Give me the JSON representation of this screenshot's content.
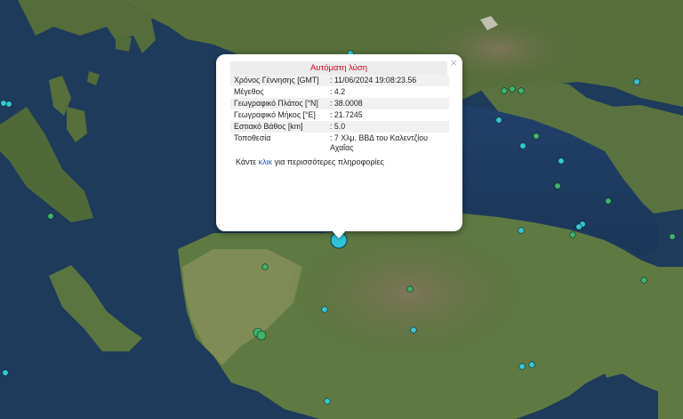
{
  "map": {
    "colors": {
      "sea": "#1d3a5a",
      "land": "#556f3d",
      "mountain": "#6b6a4d",
      "marker_small_cyan": "#35c6d6",
      "marker_small_green": "#3fb36b",
      "marker_main": "#2fc4d8"
    }
  },
  "popup": {
    "title": "Αυτόματη λύση",
    "close_glyph": "×",
    "rows": [
      {
        "label": "Χρόνος Γέννησης [GMT]",
        "value": ": 11/06/2024 19:08:23.56"
      },
      {
        "label": "Μέγεθος",
        "value": ": 4.2"
      },
      {
        "label": "Γεωγραφικό Πλάτος [°N]",
        "value": ": 38.0008"
      },
      {
        "label": "Γεωγραφικό Μήκος [°E]",
        "value": ": 21.7245"
      },
      {
        "label": "Εστιακό Βάθος [km]",
        "value": ": 5.0"
      },
      {
        "label": "Τοποθεσία",
        "value": ": 7 Χλμ. ΒΒΔ του Καλεντζίου Αχαΐας"
      }
    ],
    "more_before": "Κάντε ",
    "more_link": "κλικ",
    "more_after": " για περισσότερες πληροφορίες"
  }
}
